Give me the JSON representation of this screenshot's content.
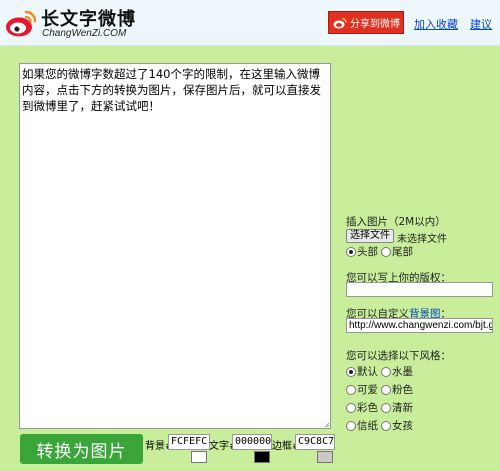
{
  "header": {
    "title": "长文字微博",
    "subtitle": "ChangWenZi.COM",
    "share_label": "分享到微博",
    "fav_label": "加入收藏",
    "suggest_label": "建议"
  },
  "editor": {
    "content": "如果您的微博字数超过了140个字的限制，在这里输入微博内容，点击下方的转换为图片，保存图片后，就可以直接发到微博里了，赶紧试试吧！"
  },
  "convert_button": "转换为图片",
  "colors": {
    "bg_label": "背景#",
    "bg_value": "FCFEFC",
    "bg_hex": "#FCFEFC",
    "text_label": "文字#",
    "text_value": "000000",
    "text_hex": "#000000",
    "border_label": "边框#",
    "border_value": "C9C8C7",
    "border_hex": "#C9C8C7"
  },
  "side": {
    "insert_image_label": "插入图片（2M以内）",
    "file_button": "选择文件",
    "file_status": "未选择文件",
    "position_options": [
      "头部",
      "尾部"
    ],
    "copyright_label": "您可以写上你的版权：",
    "copyright_value": "",
    "custom_bg_prefix": "您可以自定义",
    "custom_bg_link": "背景图",
    "custom_bg_suffix": "：",
    "bg_url_value": "http://www.changwenzi.com/bjt.gif",
    "style_label": "您可以选择以下风格：",
    "styles": [
      "默认",
      "水墨",
      "可爱",
      "粉色",
      "彩色",
      "清新",
      "信纸",
      "女孩"
    ]
  },
  "theme": {
    "page_bg": "#c9ee9b",
    "header_bg": "#eef7fb",
    "share_red": "#e03020",
    "button_green": "#3aa63a",
    "link_blue": "#0645c8"
  }
}
